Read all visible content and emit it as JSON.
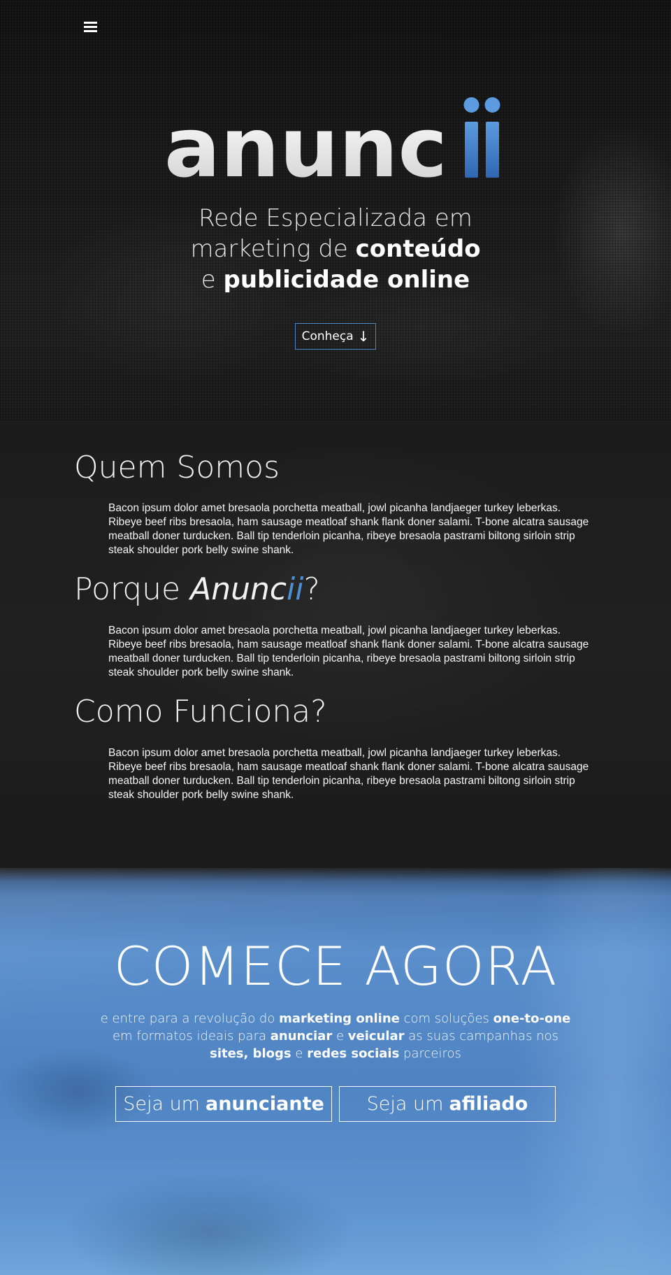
{
  "header": {
    "menu_icon": "hamburger-menu-icon"
  },
  "hero": {
    "logo_text": "anunc",
    "logo_accent": "ii",
    "tagline_line1": "Rede Especializada em",
    "tagline_line2_light": "marketing de",
    "tagline_line2_bold": "conteúdo",
    "tagline_line3_light": "e",
    "tagline_line3_bold": "publicidade online",
    "cta_label": "Conheça",
    "cta_arrow": "↓",
    "colors": {
      "accent": "#4d8fd6",
      "button_border": "#4a88cc"
    }
  },
  "about": {
    "sections": [
      {
        "title": "Quem Somos",
        "body": "Bacon ipsum dolor amet bresaola porchetta meatball, jowl picanha landjaeger turkey leberkas. Ribeye beef ribs bresaola, ham sausage meatloaf shank flank doner salami. T-bone alcatra sausage meatball doner turducken. Ball tip tenderloin picanha, ribeye bresaola pastrami biltong sirloin strip steak shoulder pork belly swine shank."
      },
      {
        "title_prefix": "Porque",
        "title_brand": "Anunc",
        "title_brand_accent": "ii",
        "title_suffix": "?",
        "body": "Bacon ipsum dolor amet bresaola porchetta meatball, jowl picanha landjaeger turkey leberkas. Ribeye beef ribs bresaola, ham sausage meatloaf shank flank doner salami. T-bone alcatra sausage meatball doner turducken. Ball tip tenderloin picanha, ribeye bresaola pastrami biltong sirloin strip steak shoulder pork belly swine shank."
      },
      {
        "title": "Como Funciona?",
        "body": "Bacon ipsum dolor amet bresaola porchetta meatball, jowl picanha landjaeger turkey leberkas. Ribeye beef ribs bresaola, ham sausage meatloaf shank flank doner salami. T-bone alcatra sausage meatball doner turducken. Ball tip tenderloin picanha, ribeye bresaola pastrami biltong sirloin strip steak shoulder pork belly swine shank."
      }
    ]
  },
  "cta": {
    "title": "COMECE AGORA",
    "line1_a": "e entre para a revolução do",
    "line1_b": "marketing online",
    "line1_c": "com soluções",
    "line1_d": "one-to-one",
    "line2_a": "em formatos ideais para",
    "line2_b": "anunciar",
    "line2_c": "e",
    "line2_d": "veicular",
    "line2_e": "as suas campanhas nos",
    "line3_a": "sites, blogs",
    "line3_b": "e",
    "line3_c": "redes sociais",
    "line3_d": "parceiros",
    "button_anunciante_light": "Seja um",
    "button_anunciante_bold": "anunciante",
    "button_afiliado_light": "Seja um",
    "button_afiliado_bold": "afiliado",
    "colors": {
      "background": "#5a8fcc"
    }
  }
}
